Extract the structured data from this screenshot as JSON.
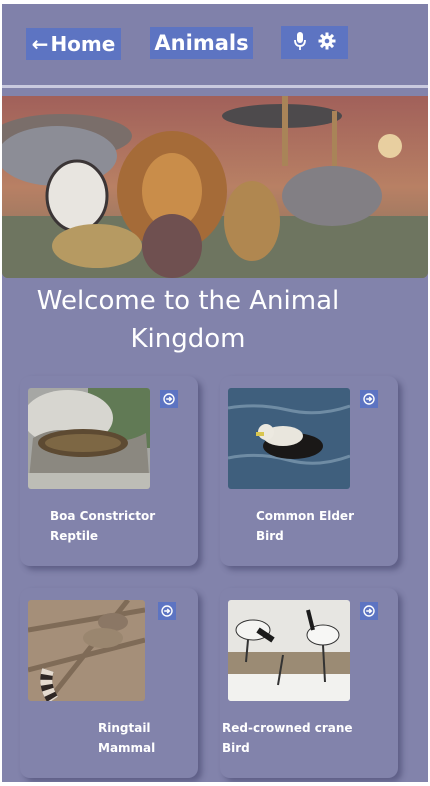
{
  "nav": {
    "home_label": "Home",
    "title": "Animals"
  },
  "welcome": {
    "line1": "Welcome to the Animal",
    "line2": "Kingdom"
  },
  "animals": [
    {
      "name": "Boa Constrictor",
      "category": "Reptile"
    },
    {
      "name": "Common Elder",
      "category": "Bird"
    },
    {
      "name": "Ringtail",
      "category": "Mammal"
    },
    {
      "name": "Red-crowned crane",
      "category": "Bird"
    }
  ],
  "colors": {
    "background": "#8283ab",
    "button": "#5d74c2",
    "text": "#ffffff"
  },
  "icons": [
    "back-arrow-icon",
    "microphone-icon",
    "gear-icon",
    "arrow-circle-right-icon"
  ]
}
